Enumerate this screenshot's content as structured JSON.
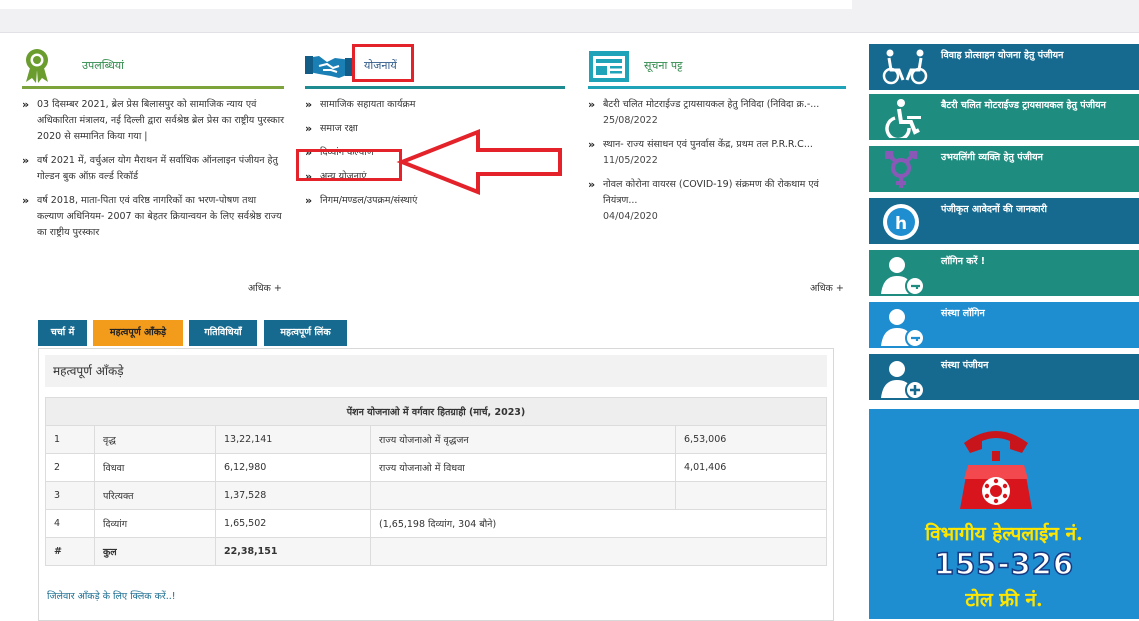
{
  "achievements": {
    "title": "उपलब्धियां",
    "items": [
      "03 दिसम्बर 2021, ब्रेल प्रेस बिलासपुर को सामाजिक न्याय एवं अधिकारिता मंत्रालय, नई दिल्ली द्वारा सर्वश्रेष्ठ ब्रेल प्रेस का राष्ट्रीय पुरस्कार 2020 से सम्मानित किया गया |",
      "वर्ष 2021 में, वर्चुअल योग मैराथन में सर्वाधिक ऑनलाइन पंजीयन हेतु गोल्डन बुक ऑफ़ वर्ल्ड रिकॉर्ड",
      "वर्ष 2018, माता-पिता एवं वरिष्ठ नागरिकों का भरण-पोषण तथा कल्याण अधिनियम- 2007 का बेहतर क्रियान्वयन के लिए सर्वश्रेष्ठ राज्य का राष्ट्रीय पुरस्कार"
    ],
    "more": "अधिक +"
  },
  "schemes": {
    "title": "योजनायें",
    "items": [
      "सामाजिक सहायता कार्यक्रम",
      "समाज रक्षा",
      "दिव्यांग कल्याण",
      "अन्य योजनाएं",
      "निगम/मण्डल/उपक्रम/संस्थाएं"
    ]
  },
  "notices": {
    "title": "सूचना पट्ट",
    "items": [
      {
        "text": "बैटरी चलित मोटराईज्ड ट्रायसायकल हेतु निविदा (निविदा क्र.-...",
        "date": "25/08/2022"
      },
      {
        "text": "स्थान- राज्य संसाधन एवं पुनर्वास केंद्र, प्रथम तल P.R.R.C...",
        "date": "11/05/2022"
      },
      {
        "text": "नोवल कोरोना वायरस (COVID-19) संक्रमण की रोकथाम एवं नियंत्रण...",
        "date": "04/04/2020"
      }
    ],
    "more": "अधिक +"
  },
  "tabs": [
    "चर्चा में",
    "महत्वपूर्ण आँकड़े",
    "गतिविधियाँ",
    "महत्वपूर्ण लिंक"
  ],
  "stats": {
    "title": "महत्वपूर्ण आँकड़े",
    "table_title": "पेंशन योजनाओ में वर्गवार हितग्राही (मार्च, 2023)",
    "rows": [
      [
        "1",
        "वृद्ध",
        "13,22,141",
        "राज्य योजनाओ में वृद्धजन",
        "6,53,006"
      ],
      [
        "2",
        "विधवा",
        "6,12,980",
        "राज्य योजनाओ में विधवा",
        "4,01,406"
      ],
      [
        "3",
        "परित्यक्त",
        "1,37,528",
        "",
        ""
      ],
      [
        "4",
        "दिव्यांग",
        "1,65,502",
        "(1,65,198 दिव्यांग, 304 बौने)",
        ""
      ],
      [
        "#",
        "कुल",
        "22,38,151",
        "",
        ""
      ]
    ],
    "district_link": "जिलेवार आँकड़े के लिए क्लिक करें..!"
  },
  "sidebar": [
    {
      "label": "विवाह प्रोत्साहन योजना हेतु पंजीयन",
      "icon": "wheelchair-couple-icon",
      "color": "#166a8f"
    },
    {
      "label": "बैटरी चलित मोटराईज्ड ट्रायसायकल हेतु पंजीयन",
      "icon": "wheelchair-user-icon",
      "color": "#1f8c80"
    },
    {
      "label": "उभयलिंगी व्यक्ति हेतु पंजीयन",
      "icon": "transgender-symbol-icon",
      "color": "#1f8c80"
    },
    {
      "label": "पंजीकृत आवेदनों की जानकारी",
      "icon": "info-app-icon",
      "color": "#166a8f"
    },
    {
      "label": "लॉगिन करें !",
      "icon": "user-key-icon",
      "color": "#1f8c80"
    },
    {
      "label": "संस्था लॉगिन",
      "icon": "user-key-icon",
      "color": "#1e8ed1"
    },
    {
      "label": "संस्था पंजीयन",
      "icon": "user-add-icon",
      "color": "#166a8f"
    }
  ],
  "helpline": {
    "line1": "विभागीय हेल्पलाईन नं.",
    "number": "155-326",
    "line2": "टोल फ्री नं."
  }
}
